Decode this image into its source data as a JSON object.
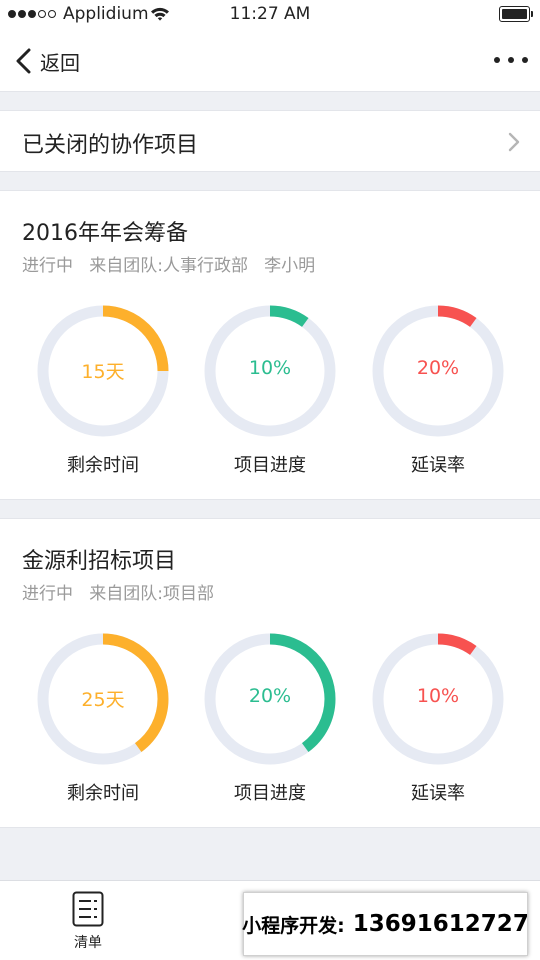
{
  "status_bar": {
    "carrier": "Applidium",
    "time": "11:27 AM",
    "signal_bars_on": 3,
    "signal_bars_total": 5
  },
  "nav": {
    "back_label": "返回",
    "back_icon": "chevron-left-icon",
    "more_icon": "more-horizontal-icon"
  },
  "closed_projects": {
    "label": "已关闭的协作项目",
    "icon": "chevron-right-icon"
  },
  "projects": [
    {
      "title": "2016年年会筹备",
      "meta": "进行中   来自团队:人事行政部   李小明",
      "stats": [
        {
          "value": "15天",
          "caption": "剩余时间",
          "progress": 0.25,
          "color": "#fdb02c"
        },
        {
          "value": "10%",
          "caption": "项目进度",
          "progress": 0.1,
          "color": "#2bbd90"
        },
        {
          "value": "20%",
          "caption": "延误率",
          "progress": 0.1,
          "color": "#f75250"
        }
      ]
    },
    {
      "title": "金源利招标项目",
      "meta": "进行中   来自团队:项目部",
      "stats": [
        {
          "value": "25天",
          "caption": "剩余时间",
          "progress": 0.4,
          "color": "#fdb02c"
        },
        {
          "value": "20%",
          "caption": "项目进度",
          "progress": 0.4,
          "color": "#2bbd90"
        },
        {
          "value": "10%",
          "caption": "延误率",
          "progress": 0.1,
          "color": "#f75250"
        }
      ]
    }
  ],
  "colors": {
    "ring_track": "#e6eaf3",
    "page_background": "#eef0f4"
  },
  "tab_bar": {
    "items": [
      {
        "label": "清单",
        "icon": "list-icon"
      }
    ]
  },
  "promo": {
    "label": "小程序开发:",
    "phone": "13691612727"
  }
}
